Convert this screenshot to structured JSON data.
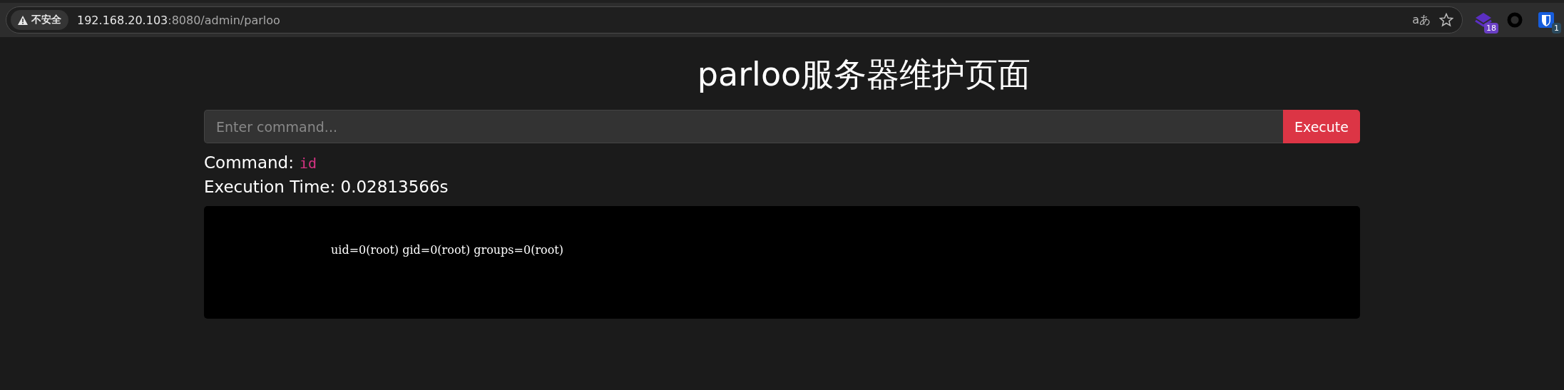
{
  "browser": {
    "security_label": "不安全",
    "url_host": "192.168.20.103",
    "url_path": ":8080/admin/parloo",
    "translate_glyph": "aあ",
    "extensions": [
      {
        "kind": "stack",
        "badge": "18"
      },
      {
        "kind": "ring"
      },
      {
        "kind": "shield",
        "badge": "1"
      }
    ]
  },
  "page": {
    "title": "parloo服务器维护页面",
    "command_field": {
      "placeholder": "Enter command..."
    },
    "execute_button": "Execute",
    "command_label": "Command:",
    "command_value": "id",
    "execution_time": "Execution Time: 0.02813566s",
    "output": "uid=0(root) gid=0(root) groups=0(root)"
  }
}
